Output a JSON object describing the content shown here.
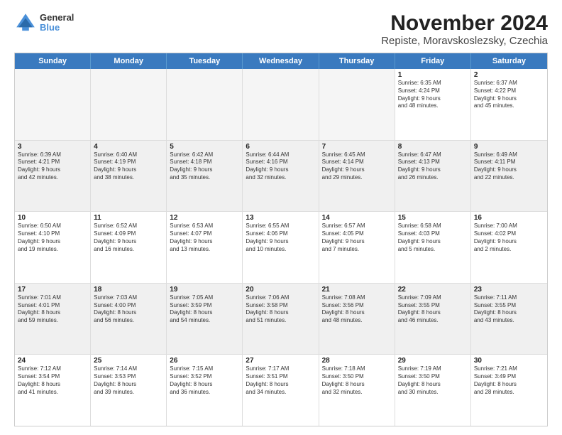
{
  "logo": {
    "general": "General",
    "blue": "Blue"
  },
  "title": "November 2024",
  "subtitle": "Repiste, Moravskoslezsky, Czechia",
  "days": [
    "Sunday",
    "Monday",
    "Tuesday",
    "Wednesday",
    "Thursday",
    "Friday",
    "Saturday"
  ],
  "rows": [
    [
      {
        "day": "",
        "text": "",
        "empty": true
      },
      {
        "day": "",
        "text": "",
        "empty": true
      },
      {
        "day": "",
        "text": "",
        "empty": true
      },
      {
        "day": "",
        "text": "",
        "empty": true
      },
      {
        "day": "",
        "text": "",
        "empty": true
      },
      {
        "day": "1",
        "text": "Sunrise: 6:35 AM\nSunset: 4:24 PM\nDaylight: 9 hours\nand 48 minutes."
      },
      {
        "day": "2",
        "text": "Sunrise: 6:37 AM\nSunset: 4:22 PM\nDaylight: 9 hours\nand 45 minutes."
      }
    ],
    [
      {
        "day": "3",
        "text": "Sunrise: 6:39 AM\nSunset: 4:21 PM\nDaylight: 9 hours\nand 42 minutes.",
        "shaded": true
      },
      {
        "day": "4",
        "text": "Sunrise: 6:40 AM\nSunset: 4:19 PM\nDaylight: 9 hours\nand 38 minutes.",
        "shaded": true
      },
      {
        "day": "5",
        "text": "Sunrise: 6:42 AM\nSunset: 4:18 PM\nDaylight: 9 hours\nand 35 minutes.",
        "shaded": true
      },
      {
        "day": "6",
        "text": "Sunrise: 6:44 AM\nSunset: 4:16 PM\nDaylight: 9 hours\nand 32 minutes.",
        "shaded": true
      },
      {
        "day": "7",
        "text": "Sunrise: 6:45 AM\nSunset: 4:14 PM\nDaylight: 9 hours\nand 29 minutes.",
        "shaded": true
      },
      {
        "day": "8",
        "text": "Sunrise: 6:47 AM\nSunset: 4:13 PM\nDaylight: 9 hours\nand 26 minutes.",
        "shaded": true
      },
      {
        "day": "9",
        "text": "Sunrise: 6:49 AM\nSunset: 4:11 PM\nDaylight: 9 hours\nand 22 minutes.",
        "shaded": true
      }
    ],
    [
      {
        "day": "10",
        "text": "Sunrise: 6:50 AM\nSunset: 4:10 PM\nDaylight: 9 hours\nand 19 minutes."
      },
      {
        "day": "11",
        "text": "Sunrise: 6:52 AM\nSunset: 4:09 PM\nDaylight: 9 hours\nand 16 minutes."
      },
      {
        "day": "12",
        "text": "Sunrise: 6:53 AM\nSunset: 4:07 PM\nDaylight: 9 hours\nand 13 minutes."
      },
      {
        "day": "13",
        "text": "Sunrise: 6:55 AM\nSunset: 4:06 PM\nDaylight: 9 hours\nand 10 minutes."
      },
      {
        "day": "14",
        "text": "Sunrise: 6:57 AM\nSunset: 4:05 PM\nDaylight: 9 hours\nand 7 minutes."
      },
      {
        "day": "15",
        "text": "Sunrise: 6:58 AM\nSunset: 4:03 PM\nDaylight: 9 hours\nand 5 minutes."
      },
      {
        "day": "16",
        "text": "Sunrise: 7:00 AM\nSunset: 4:02 PM\nDaylight: 9 hours\nand 2 minutes."
      }
    ],
    [
      {
        "day": "17",
        "text": "Sunrise: 7:01 AM\nSunset: 4:01 PM\nDaylight: 8 hours\nand 59 minutes.",
        "shaded": true
      },
      {
        "day": "18",
        "text": "Sunrise: 7:03 AM\nSunset: 4:00 PM\nDaylight: 8 hours\nand 56 minutes.",
        "shaded": true
      },
      {
        "day": "19",
        "text": "Sunrise: 7:05 AM\nSunset: 3:59 PM\nDaylight: 8 hours\nand 54 minutes.",
        "shaded": true
      },
      {
        "day": "20",
        "text": "Sunrise: 7:06 AM\nSunset: 3:58 PM\nDaylight: 8 hours\nand 51 minutes.",
        "shaded": true
      },
      {
        "day": "21",
        "text": "Sunrise: 7:08 AM\nSunset: 3:56 PM\nDaylight: 8 hours\nand 48 minutes.",
        "shaded": true
      },
      {
        "day": "22",
        "text": "Sunrise: 7:09 AM\nSunset: 3:55 PM\nDaylight: 8 hours\nand 46 minutes.",
        "shaded": true
      },
      {
        "day": "23",
        "text": "Sunrise: 7:11 AM\nSunset: 3:55 PM\nDaylight: 8 hours\nand 43 minutes.",
        "shaded": true
      }
    ],
    [
      {
        "day": "24",
        "text": "Sunrise: 7:12 AM\nSunset: 3:54 PM\nDaylight: 8 hours\nand 41 minutes."
      },
      {
        "day": "25",
        "text": "Sunrise: 7:14 AM\nSunset: 3:53 PM\nDaylight: 8 hours\nand 39 minutes."
      },
      {
        "day": "26",
        "text": "Sunrise: 7:15 AM\nSunset: 3:52 PM\nDaylight: 8 hours\nand 36 minutes."
      },
      {
        "day": "27",
        "text": "Sunrise: 7:17 AM\nSunset: 3:51 PM\nDaylight: 8 hours\nand 34 minutes."
      },
      {
        "day": "28",
        "text": "Sunrise: 7:18 AM\nSunset: 3:50 PM\nDaylight: 8 hours\nand 32 minutes."
      },
      {
        "day": "29",
        "text": "Sunrise: 7:19 AM\nSunset: 3:50 PM\nDaylight: 8 hours\nand 30 minutes."
      },
      {
        "day": "30",
        "text": "Sunrise: 7:21 AM\nSunset: 3:49 PM\nDaylight: 8 hours\nand 28 minutes."
      }
    ]
  ]
}
